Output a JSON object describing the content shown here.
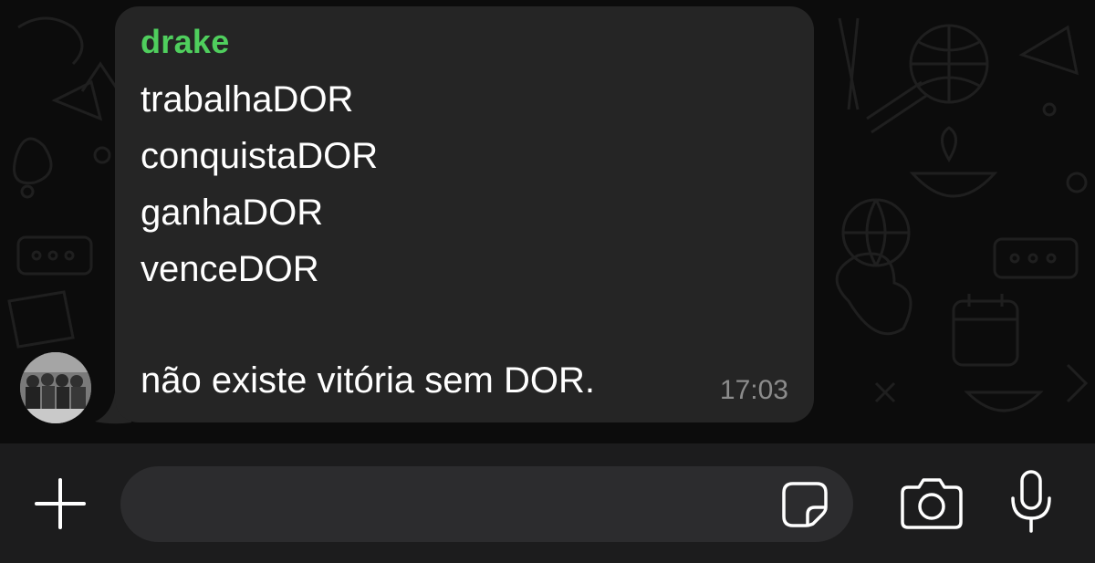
{
  "message": {
    "sender": "drake",
    "lines": [
      "trabalhaDOR",
      "conquistaDOR",
      "ganhaDOR",
      "venceDOR",
      "",
      "não existe vitória sem DOR."
    ],
    "time": "17:03"
  },
  "composer": {
    "text_value": "",
    "buttons": [
      "plus-icon",
      "sticker-icon",
      "camera-icon",
      "microphone-icon"
    ]
  },
  "colors": {
    "sender_name": "#4fce5d",
    "bubble": "#252525",
    "chat_background": "#0c0c0c",
    "input_bar": "#1c1c1d",
    "input_field": "#2c2c2e",
    "timestamp": "#8c8c8c"
  }
}
